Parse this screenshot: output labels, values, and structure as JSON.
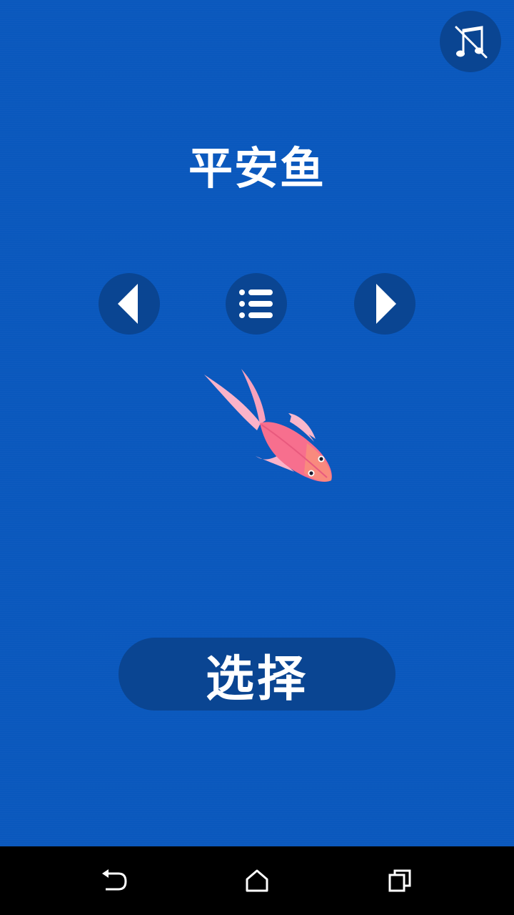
{
  "game": {
    "title": "平安鱼",
    "select_label": "选择"
  },
  "controls": {
    "mute_icon": "music-muted-icon",
    "prev_icon": "triangle-left-icon",
    "list_icon": "list-icon",
    "next_icon": "triangle-right-icon"
  },
  "navbar": {
    "back_icon": "back-icon",
    "home_icon": "home-icon",
    "recent_icon": "recent-apps-icon"
  },
  "colors": {
    "background": "#0a58bd",
    "button": "#0a4592",
    "fish_body": "#f76f8e",
    "fish_fin": "#fbb3c9"
  }
}
